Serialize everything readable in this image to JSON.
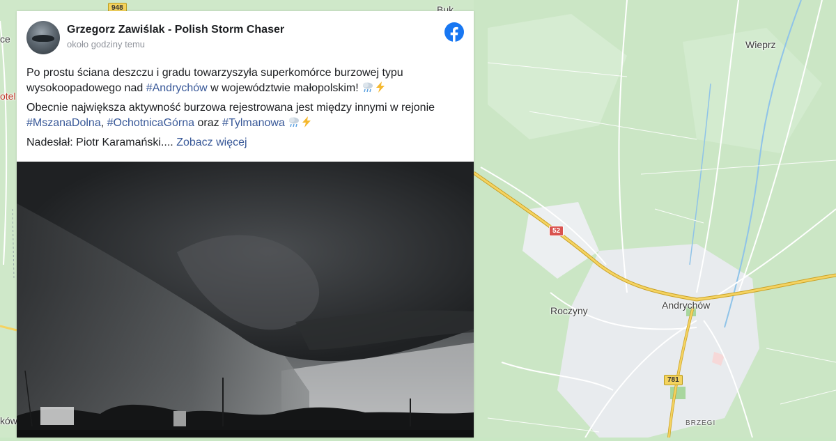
{
  "map": {
    "labels": {
      "wieprz": "Wieprz",
      "roczyny": "Roczyny",
      "andrychow": "Andrychów",
      "brzegi": "BRZEGI",
      "buk": "Buk",
      "left_top": "ce",
      "left_mid": "otel",
      "left_bottom": "ków"
    },
    "road_shields": {
      "r948": "948",
      "r52": "52",
      "r781": "781"
    },
    "colors": {
      "land": "#c9e7c4",
      "urban": "#e9ecef",
      "main_road": "#f2c94c",
      "minor_road": "#ffffff",
      "water": "#8fc3e8"
    }
  },
  "post": {
    "author": "Grzegorz Zawiślak - Polish Storm Chaser",
    "timestamp": "około godziny temu",
    "platform_icon": "facebook-icon",
    "paragraph1": {
      "text_a": "Po prostu ściana deszczu i gradu towarzyszyła superkomórce burzowej typu wysokoopadowego nad ",
      "hashtag_andrychow": "#Andrychów",
      "text_b": " w województwie małopolskim!"
    },
    "paragraph2": {
      "text_a": "Obecnie największa aktywność burzowa rejestrowana jest między innymi w rejonie ",
      "hashtag_mszana": "#MszanaDolna",
      "sep1": ", ",
      "hashtag_ochotnica": "#OchotnicaGórna",
      "text_b": " oraz ",
      "hashtag_tylmanowa": "#Tylmanowa"
    },
    "paragraph3": {
      "text_a": "Nadesłał: Piotr Karamański.... ",
      "see_more": "Zobacz więcej"
    },
    "emoji_icons": [
      "cloud-rain-icon",
      "lightning-icon"
    ],
    "photo": "storm-shelf-cloud-photo"
  }
}
